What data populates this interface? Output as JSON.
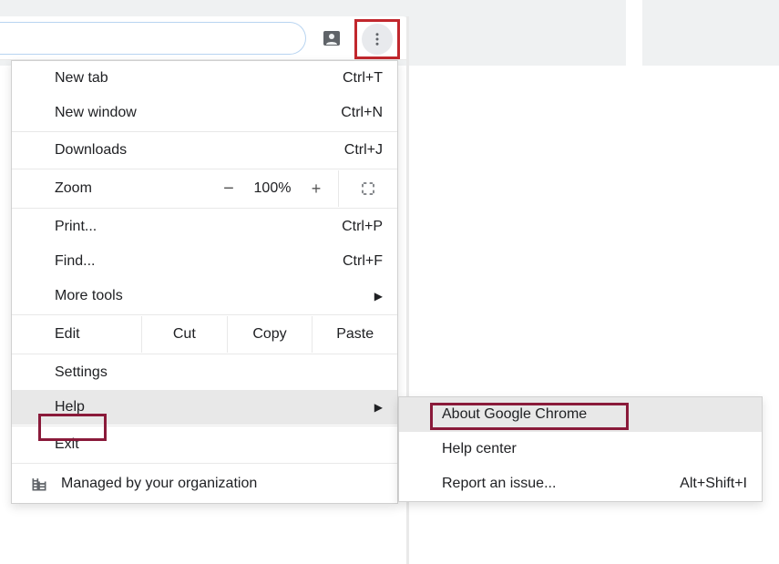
{
  "toolbar": {
    "profile_icon": "profile",
    "more_icon": "more-vertical"
  },
  "menu": {
    "new_tab": {
      "label": "New tab",
      "shortcut": "Ctrl+T"
    },
    "new_window": {
      "label": "New window",
      "shortcut": "Ctrl+N"
    },
    "downloads": {
      "label": "Downloads",
      "shortcut": "Ctrl+J"
    },
    "zoom": {
      "label": "Zoom",
      "minus": "−",
      "value": "100%",
      "plus": "+"
    },
    "print": {
      "label": "Print...",
      "shortcut": "Ctrl+P"
    },
    "find": {
      "label": "Find...",
      "shortcut": "Ctrl+F"
    },
    "more_tools": {
      "label": "More tools"
    },
    "edit": {
      "label": "Edit",
      "cut": "Cut",
      "copy": "Copy",
      "paste": "Paste"
    },
    "settings": {
      "label": "Settings"
    },
    "help": {
      "label": "Help"
    },
    "exit": {
      "label": "Exit"
    },
    "managed": {
      "label": "Managed by your organization"
    }
  },
  "submenu": {
    "about": {
      "label": "About Google Chrome"
    },
    "help_center": {
      "label": "Help center"
    },
    "report": {
      "label": "Report an issue...",
      "shortcut": "Alt+Shift+I"
    }
  }
}
